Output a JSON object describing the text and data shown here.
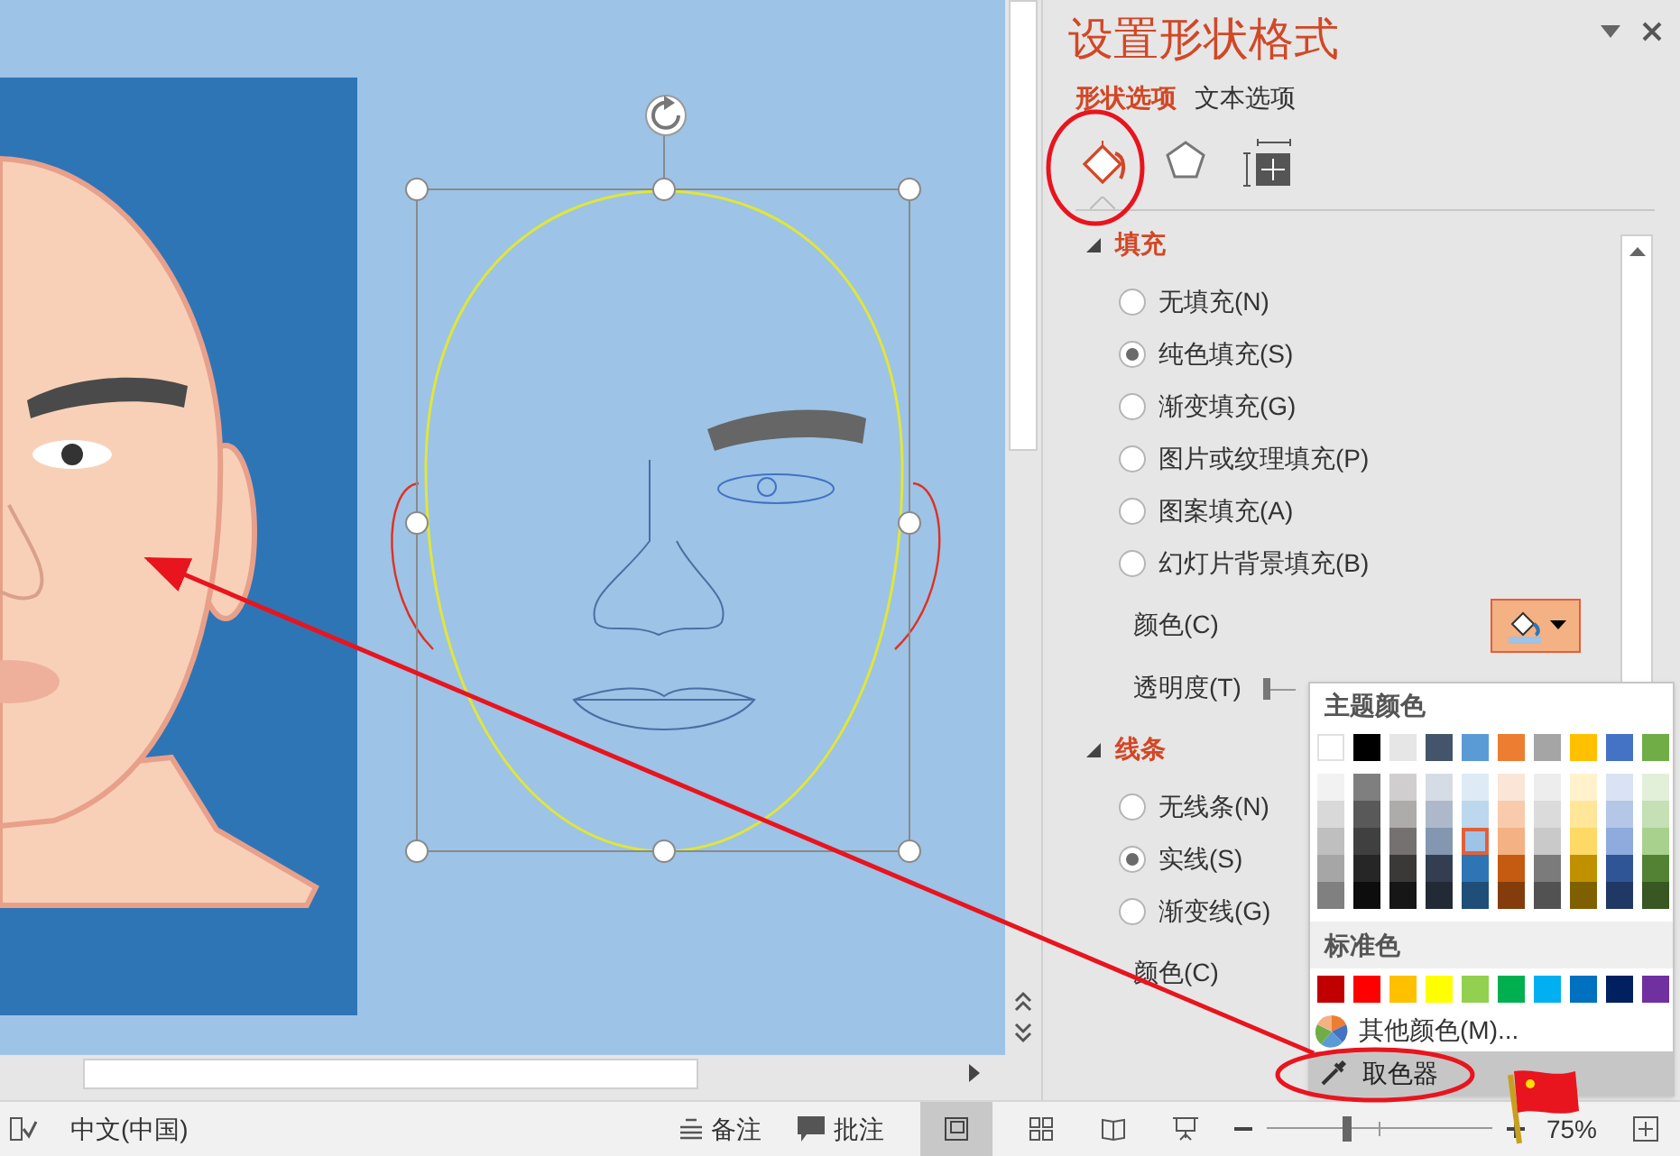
{
  "pane": {
    "title": "设置形状格式",
    "tabs": [
      {
        "label": "形状选项",
        "selected": true
      },
      {
        "label": "文本选项",
        "selected": false
      }
    ],
    "icon_tabs": [
      {
        "kind": "fill",
        "selected": true
      },
      {
        "kind": "effects",
        "selected": false
      },
      {
        "kind": "size",
        "selected": false
      }
    ],
    "sections": [
      {
        "title": "填充",
        "expanded": true,
        "options": [
          {
            "label": "无填充(N)",
            "selected": false
          },
          {
            "label": "纯色填充(S)",
            "selected": true
          },
          {
            "label": "渐变填充(G)",
            "selected": false
          },
          {
            "label": "图片或纹理填充(P)",
            "selected": false
          },
          {
            "label": "图案填充(A)",
            "selected": false
          },
          {
            "label": "幻灯片背景填充(B)",
            "selected": false
          }
        ],
        "color_label": "颜色(C)",
        "transparency": {
          "label": "透明度(T)",
          "level": 0
        }
      },
      {
        "title": "线条",
        "expanded": true,
        "options": [
          {
            "label": "无线条(N)",
            "selected": false
          },
          {
            "label": "实线(S)",
            "selected": true
          },
          {
            "label": "渐变线(G)",
            "selected": false
          }
        ],
        "color_label": "颜色(C)"
      }
    ]
  },
  "color_menu": {
    "theme_title": "主题颜色",
    "theme_colors": [
      {
        "color": "#ffffff",
        "selected": false
      },
      {
        "color": "#000000",
        "selected": false
      },
      {
        "color": "#e7e6e6",
        "selected": false
      },
      {
        "color": "#44546a",
        "selected": false
      },
      {
        "color": "#5b9bd5",
        "selected": false
      },
      {
        "color": "#ed7d31",
        "selected": false
      },
      {
        "color": "#a5a5a5",
        "selected": false
      },
      {
        "color": "#ffc000",
        "selected": false
      },
      {
        "color": "#4472c4",
        "selected": false
      },
      {
        "color": "#70ad47",
        "selected": false
      }
    ],
    "shade_rows": [
      {
        "swatches": [
          {
            "color": "#f2f2f2",
            "selected": false
          },
          {
            "color": "#7f7f7f",
            "selected": false
          },
          {
            "color": "#d0cece",
            "selected": false
          },
          {
            "color": "#d6dce5",
            "selected": false
          },
          {
            "color": "#deebf7",
            "selected": false
          },
          {
            "color": "#fbe5d6",
            "selected": false
          },
          {
            "color": "#ededed",
            "selected": false
          },
          {
            "color": "#fff2cc",
            "selected": false
          },
          {
            "color": "#dae3f3",
            "selected": false
          },
          {
            "color": "#e2f0d9",
            "selected": false
          }
        ]
      },
      {
        "swatches": [
          {
            "color": "#d9d9d9",
            "selected": false
          },
          {
            "color": "#595959",
            "selected": false
          },
          {
            "color": "#aeabab",
            "selected": false
          },
          {
            "color": "#adb9ca",
            "selected": false
          },
          {
            "color": "#bdd7ee",
            "selected": false
          },
          {
            "color": "#f8cbad",
            "selected": false
          },
          {
            "color": "#dbdbdb",
            "selected": false
          },
          {
            "color": "#ffe699",
            "selected": false
          },
          {
            "color": "#b4c7e7",
            "selected": false
          },
          {
            "color": "#c5e0b4",
            "selected": false
          }
        ]
      },
      {
        "swatches": [
          {
            "color": "#bfbfbf",
            "selected": false
          },
          {
            "color": "#404040",
            "selected": false
          },
          {
            "color": "#757171",
            "selected": false
          },
          {
            "color": "#8497b0",
            "selected": false
          },
          {
            "color": "#9dc3e6",
            "selected": true
          },
          {
            "color": "#f4b183",
            "selected": false
          },
          {
            "color": "#c9c9c9",
            "selected": false
          },
          {
            "color": "#ffd966",
            "selected": false
          },
          {
            "color": "#8faadc",
            "selected": false
          },
          {
            "color": "#a9d18e",
            "selected": false
          }
        ]
      },
      {
        "swatches": [
          {
            "color": "#a6a6a6",
            "selected": false
          },
          {
            "color": "#262626",
            "selected": false
          },
          {
            "color": "#3b3838",
            "selected": false
          },
          {
            "color": "#333f50",
            "selected": false
          },
          {
            "color": "#2e75b6",
            "selected": false
          },
          {
            "color": "#c55a11",
            "selected": false
          },
          {
            "color": "#7b7b7b",
            "selected": false
          },
          {
            "color": "#bf9000",
            "selected": false
          },
          {
            "color": "#2f5597",
            "selected": false
          },
          {
            "color": "#548235",
            "selected": false
          }
        ]
      },
      {
        "swatches": [
          {
            "color": "#808080",
            "selected": false
          },
          {
            "color": "#0d0d0d",
            "selected": false
          },
          {
            "color": "#171616",
            "selected": false
          },
          {
            "color": "#222a35",
            "selected": false
          },
          {
            "color": "#1f4e79",
            "selected": false
          },
          {
            "color": "#843c0c",
            "selected": false
          },
          {
            "color": "#525252",
            "selected": false
          },
          {
            "color": "#7f6000",
            "selected": false
          },
          {
            "color": "#203864",
            "selected": false
          },
          {
            "color": "#385723",
            "selected": false
          }
        ]
      }
    ],
    "standard_title": "标准色",
    "standard_colors": [
      {
        "color": "#c00000",
        "selected": false
      },
      {
        "color": "#ff0000",
        "selected": false
      },
      {
        "color": "#ffc000",
        "selected": false
      },
      {
        "color": "#ffff00",
        "selected": false
      },
      {
        "color": "#92d050",
        "selected": false
      },
      {
        "color": "#00b050",
        "selected": false
      },
      {
        "color": "#00b0f0",
        "selected": false
      },
      {
        "color": "#0070c0",
        "selected": false
      },
      {
        "color": "#002060",
        "selected": false
      },
      {
        "color": "#7030a0",
        "selected": false
      }
    ],
    "more_colors": "其他颜色(M)...",
    "eyedropper": "取色器"
  },
  "status_bar": {
    "language": "中文(中国)",
    "notes": "备注",
    "comments": "批注",
    "zoom_slider": {
      "level": 0.35
    },
    "zoom": "75%"
  }
}
